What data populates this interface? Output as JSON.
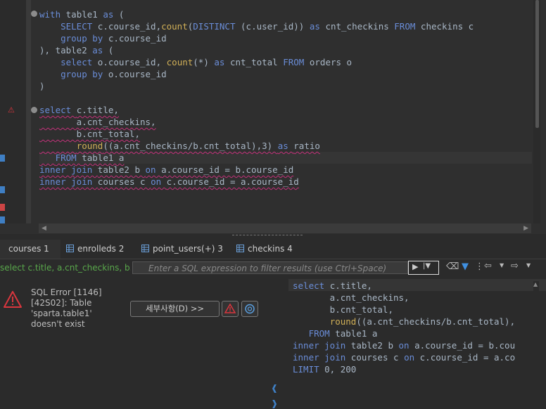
{
  "editor": {
    "lines": [
      [
        [
          "kw",
          "with "
        ],
        [
          "id",
          "table1 "
        ],
        [
          "kw",
          "as "
        ],
        [
          "id",
          "("
        ]
      ],
      [
        [
          "id",
          "    "
        ],
        [
          "kw",
          "SELECT "
        ],
        [
          "id",
          "c.course_id,"
        ],
        [
          "fn",
          "count"
        ],
        [
          "id",
          "("
        ],
        [
          "kw",
          "DISTINCT "
        ],
        [
          "id",
          "(c.user_id)) "
        ],
        [
          "kw",
          "as "
        ],
        [
          "id",
          "cnt_checkins "
        ],
        [
          "kw",
          "FROM "
        ],
        [
          "id",
          "checkins c"
        ]
      ],
      [
        [
          "id",
          "    "
        ],
        [
          "kw",
          "group by "
        ],
        [
          "id",
          "c.course_id"
        ]
      ],
      [
        [
          "id",
          "), table2 "
        ],
        [
          "kw",
          "as "
        ],
        [
          "id",
          "("
        ]
      ],
      [
        [
          "id",
          "    "
        ],
        [
          "kw",
          "select "
        ],
        [
          "id",
          "o.course_id, "
        ],
        [
          "fn",
          "count"
        ],
        [
          "id",
          "(*) "
        ],
        [
          "kw",
          "as "
        ],
        [
          "id",
          "cnt_total "
        ],
        [
          "kw",
          "FROM "
        ],
        [
          "id",
          "orders o"
        ]
      ],
      [
        [
          "id",
          "    "
        ],
        [
          "kw",
          "group by "
        ],
        [
          "id",
          "o.course_id"
        ]
      ],
      [
        [
          "id",
          ")"
        ]
      ],
      [
        [
          "id",
          ""
        ]
      ],
      [
        [
          "kw",
          "select "
        ],
        [
          "id",
          "c.title,"
        ]
      ],
      [
        [
          "id",
          "       a.cnt_checkins,"
        ]
      ],
      [
        [
          "id",
          "       b.cnt_total,"
        ]
      ],
      [
        [
          "id",
          "       "
        ],
        [
          "fn",
          "round"
        ],
        [
          "id",
          "((a.cnt_checkins/b.cnt_total),3) "
        ],
        [
          "kw",
          "as "
        ],
        [
          "id",
          "ratio"
        ]
      ],
      [
        [
          "id",
          "   "
        ],
        [
          "kw",
          "FROM "
        ],
        [
          "id",
          "table1 a"
        ]
      ],
      [
        [
          "kw",
          "inner join "
        ],
        [
          "id",
          "table2 b "
        ],
        [
          "kw",
          "on "
        ],
        [
          "id",
          "a.course_id = b.course_id"
        ]
      ],
      [
        [
          "kw",
          "inner join "
        ],
        [
          "id",
          "courses c "
        ],
        [
          "kw",
          "on "
        ],
        [
          "id",
          "c.course_id = a.course_id"
        ]
      ]
    ]
  },
  "tabs": [
    {
      "label": "courses 1",
      "active": true
    },
    {
      "label": "enrolleds 2",
      "active": false
    },
    {
      "label": "point_users(+) 3",
      "active": false
    },
    {
      "label": "checkins 4",
      "active": false
    }
  ],
  "filter": {
    "query_text": "select c.title, a.cnt_checkins, b.c",
    "placeholder": "Enter a SQL expression to filter results (use Ctrl+Space)"
  },
  "error": {
    "message": "SQL Error [1146] [42S02]: Table 'sparta.table1' doesn't exist",
    "details_button": "세부사항(D) >>"
  },
  "result_sql": {
    "lines": [
      [
        [
          "kw",
          "select "
        ],
        [
          "id",
          "c.title,"
        ]
      ],
      [
        [
          "id",
          "       a.cnt_checkins,"
        ]
      ],
      [
        [
          "id",
          "       b.cnt_total,"
        ]
      ],
      [
        [
          "id",
          "       "
        ],
        [
          "fn",
          "round"
        ],
        [
          "id",
          "((a.cnt_checkins/b.cnt_total),"
        ]
      ],
      [
        [
          "id",
          "   "
        ],
        [
          "kw",
          "FROM "
        ],
        [
          "id",
          "table1 a"
        ]
      ],
      [
        [
          "kw",
          "inner join "
        ],
        [
          "id",
          "table2 b "
        ],
        [
          "kw",
          "on "
        ],
        [
          "id",
          "a.course_id = b.cou"
        ]
      ],
      [
        [
          "kw",
          "inner join "
        ],
        [
          "id",
          "courses c "
        ],
        [
          "kw",
          "on "
        ],
        [
          "id",
          "c.course_id = a.co"
        ]
      ],
      [
        [
          "kw",
          "LIMIT "
        ],
        [
          "id",
          "0, 200"
        ]
      ]
    ]
  },
  "colors": {
    "keyword": "#6a8dd8",
    "function": "#d1b057",
    "error": "#d9363e",
    "filter_green": "#59a84b"
  }
}
